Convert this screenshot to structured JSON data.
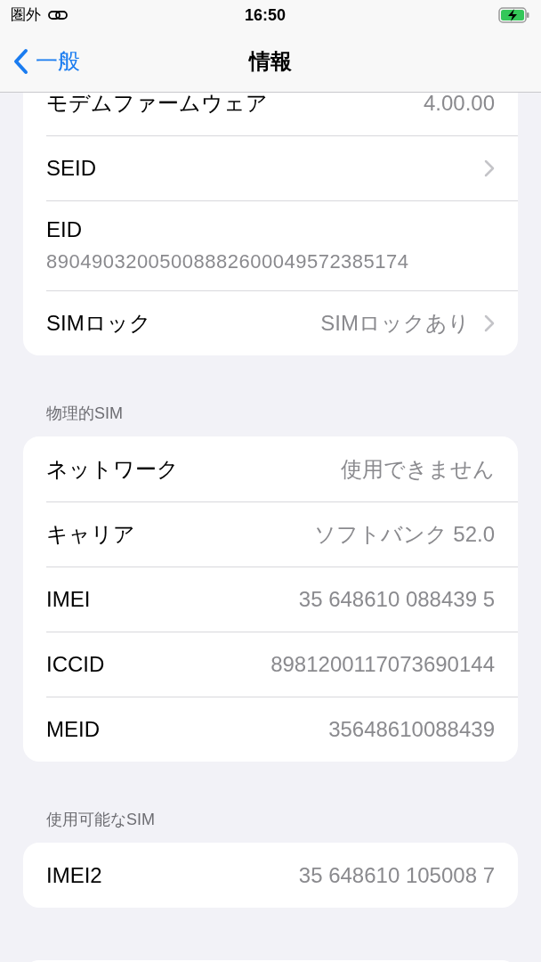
{
  "status_bar": {
    "carrier": "圏外",
    "time": "16:50"
  },
  "nav": {
    "back": "一般",
    "title": "情報"
  },
  "sections": [
    {
      "rows": [
        {
          "kind": "value",
          "label": "モデムファームウェア",
          "value": "4.00.00",
          "chevron": false
        },
        {
          "kind": "value",
          "label": "SEID",
          "chevron": true
        },
        {
          "kind": "stacked",
          "label": "EID",
          "value": "89049032005008882600049572385174",
          "chevron": false
        },
        {
          "kind": "value",
          "label": "SIMロック",
          "value": "SIMロックあり",
          "chevron": true
        }
      ]
    },
    {
      "header": "物理的SIM",
      "rows": [
        {
          "kind": "value",
          "label": "ネットワーク",
          "value": "使用できません",
          "chevron": false
        },
        {
          "kind": "value",
          "label": "キャリア",
          "value": "ソフトバンク 52.0",
          "chevron": false
        },
        {
          "kind": "value",
          "label": "IMEI",
          "value": "35 648610 088439 5",
          "chevron": false
        },
        {
          "kind": "value",
          "label": "ICCID",
          "value": "8981200117073690144",
          "chevron": false
        },
        {
          "kind": "value",
          "label": "MEID",
          "value": "35648610088439",
          "chevron": false
        }
      ]
    },
    {
      "header": "使用可能なSIM",
      "rows": [
        {
          "kind": "value",
          "label": "IMEI2",
          "value": "35 648610 105008 7",
          "chevron": false
        }
      ]
    }
  ]
}
